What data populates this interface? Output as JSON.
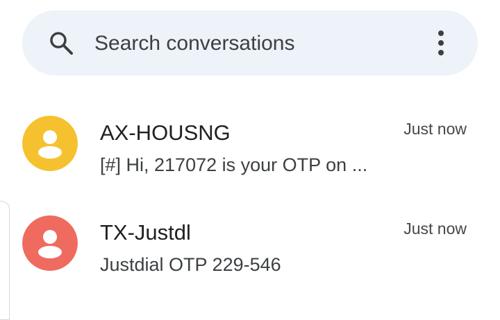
{
  "search": {
    "placeholder": "Search conversations",
    "search_icon": "search-icon",
    "more_icon": "more-vertical-icon"
  },
  "colors": {
    "search_bg": "#eef2f9",
    "avatar_yellow": "#f6c12f",
    "avatar_red": "#ef6b5f",
    "text_primary": "#1f1f1f",
    "text_secondary": "#3c4043"
  },
  "conversations": [
    {
      "name": "AX-HOUSNG",
      "snippet": "[#] Hi, 217072 is your OTP on ...",
      "time": "Just now",
      "avatar_color": "#f6c12f",
      "avatar_icon": "person-icon"
    },
    {
      "name": "TX-Justdl",
      "snippet": "Justdial OTP 229-546",
      "time": "Just now",
      "avatar_color": "#ef6b5f",
      "avatar_icon": "person-icon"
    }
  ]
}
